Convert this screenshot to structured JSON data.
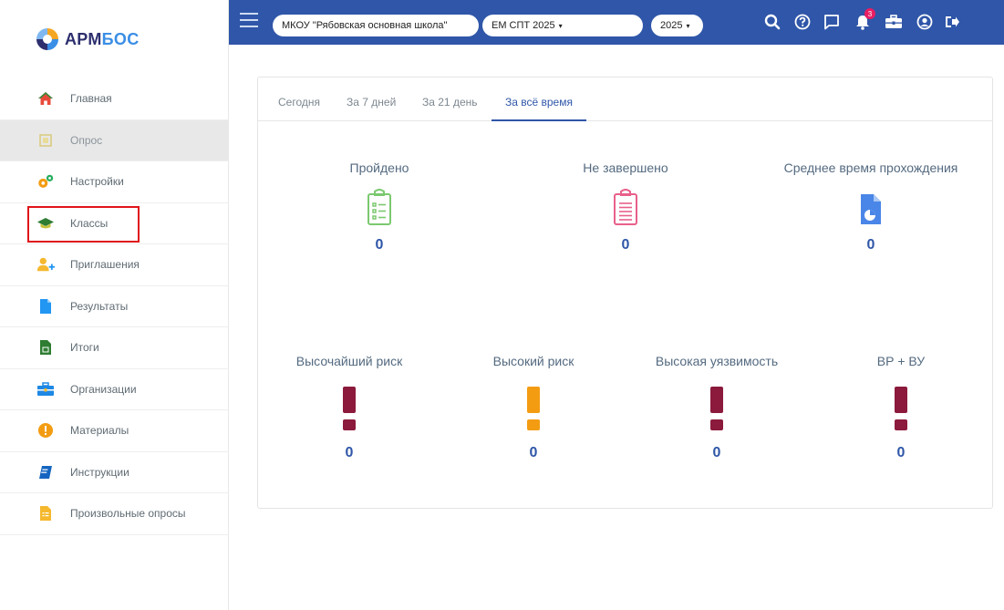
{
  "logo": {
    "text_a": "АРМ",
    "text_b": "БОС"
  },
  "sidebar": {
    "items": [
      {
        "label": "Главная",
        "icon": "home-icon",
        "active": false
      },
      {
        "label": "Опрос",
        "icon": "survey-icon",
        "active": true
      },
      {
        "label": "Настройки",
        "icon": "gears-icon",
        "active": false
      },
      {
        "label": "Классы",
        "icon": "graduation-cap-icon",
        "active": false,
        "highlighted": true
      },
      {
        "label": "Приглашения",
        "icon": "user-add-icon",
        "active": false
      },
      {
        "label": "Результаты",
        "icon": "document-icon",
        "active": false
      },
      {
        "label": "Итоги",
        "icon": "spreadsheet-icon",
        "active": false
      },
      {
        "label": "Организации",
        "icon": "briefcase-icon",
        "active": false
      },
      {
        "label": "Материалы",
        "icon": "alert-circle-icon",
        "active": false
      },
      {
        "label": "Инструкции",
        "icon": "book-icon",
        "active": false
      },
      {
        "label": "Произвольные опросы",
        "icon": "list-document-icon",
        "active": false
      }
    ]
  },
  "topbar": {
    "organization": "МКОУ \"Рябовская основная школа\"",
    "survey": "ЕМ СПТ 2025",
    "year": "2025",
    "notification_count": "3",
    "icons": [
      "search-icon",
      "help-icon",
      "chat-icon",
      "bell-icon",
      "briefcase-icon",
      "account-icon",
      "logout-icon"
    ]
  },
  "tabs": {
    "items": [
      "Сегодня",
      "За 7 дней",
      "За 21 день",
      "За всё время"
    ],
    "active_index": 3
  },
  "stats_top": [
    {
      "title": "Пройдено",
      "value": "0",
      "icon": "clipboard-check-icon",
      "color": "#7bc96f"
    },
    {
      "title": "Не завершено",
      "value": "0",
      "icon": "clipboard-list-icon",
      "color": "#e8608a"
    },
    {
      "title": "Среднее время прохождения",
      "value": "0",
      "icon": "pie-document-icon",
      "color": "#4a86e8"
    }
  ],
  "stats_bottom": [
    {
      "title": "Высочайший риск",
      "value": "0",
      "icon": "exclamation-icon",
      "color": "#8b1a3c"
    },
    {
      "title": "Высокий риск",
      "value": "0",
      "icon": "exclamation-icon",
      "color": "#f39c12"
    },
    {
      "title": "Высокая уязвимость",
      "value": "0",
      "icon": "exclamation-icon",
      "color": "#8b1a3c"
    },
    {
      "title": "ВР + ВУ",
      "value": "0",
      "icon": "exclamation-icon",
      "color": "#8b1a3c"
    }
  ]
}
